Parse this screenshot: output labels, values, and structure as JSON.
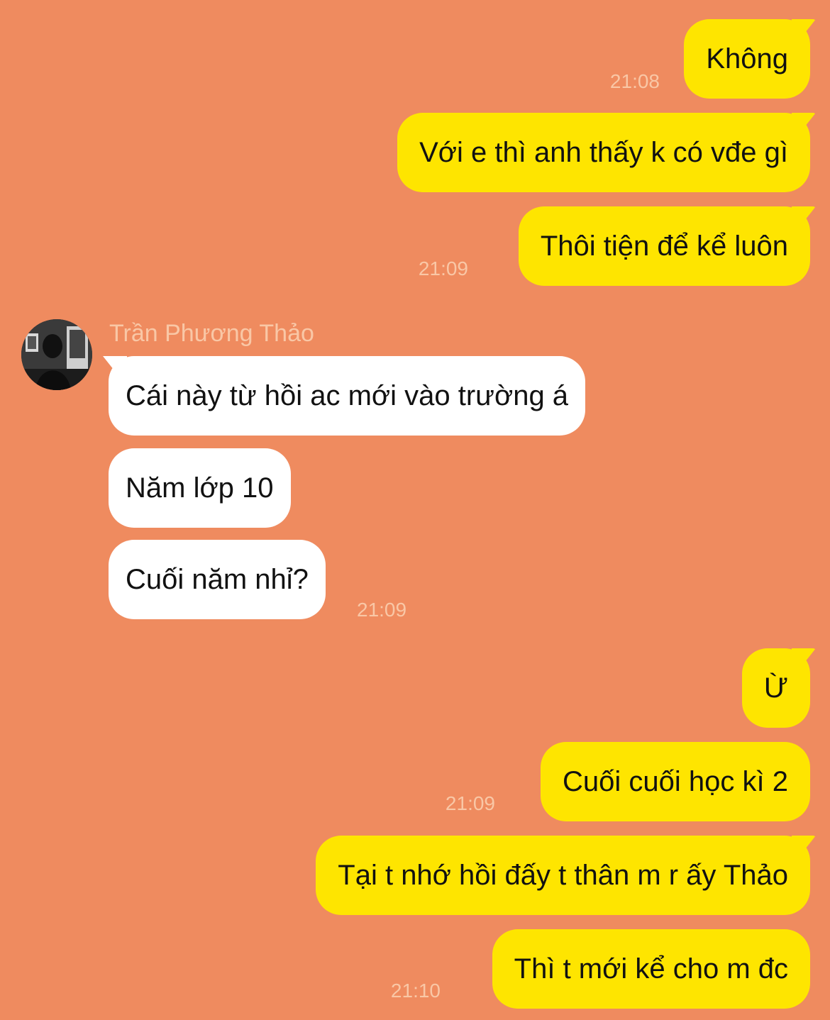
{
  "colors": {
    "background": "#EF8B5F",
    "outgoing_bubble": "#FEE500",
    "incoming_bubble": "#FFFFFF",
    "timestamp": "#F9C7A6"
  },
  "contact": {
    "name": "Trần Phương Thảo",
    "avatar_icon": "profile-photo-icon"
  },
  "messages": [
    {
      "direction": "out",
      "text": "Không",
      "time": "21:08"
    },
    {
      "direction": "out",
      "text": "Với e thì anh thấy k có vđe gì",
      "time": ""
    },
    {
      "direction": "out",
      "text": "Thôi tiện để kể luôn",
      "time": "21:09"
    },
    {
      "direction": "in",
      "text": "Cái này từ hồi ac mới vào trường á",
      "time": ""
    },
    {
      "direction": "in",
      "text": "Năm lớp 10",
      "time": ""
    },
    {
      "direction": "in",
      "text": "Cuối năm nhỉ?",
      "time": "21:09"
    },
    {
      "direction": "out",
      "text": "Ừ",
      "time": ""
    },
    {
      "direction": "out",
      "text": "Cuối cuối học kì 2",
      "time": "21:09"
    },
    {
      "direction": "out",
      "text": "Tại t nhớ hồi đấy t thân m r ấy Thảo",
      "time": ""
    },
    {
      "direction": "out",
      "text": "Thì t mới kể cho m đc",
      "time": "21:10"
    }
  ]
}
